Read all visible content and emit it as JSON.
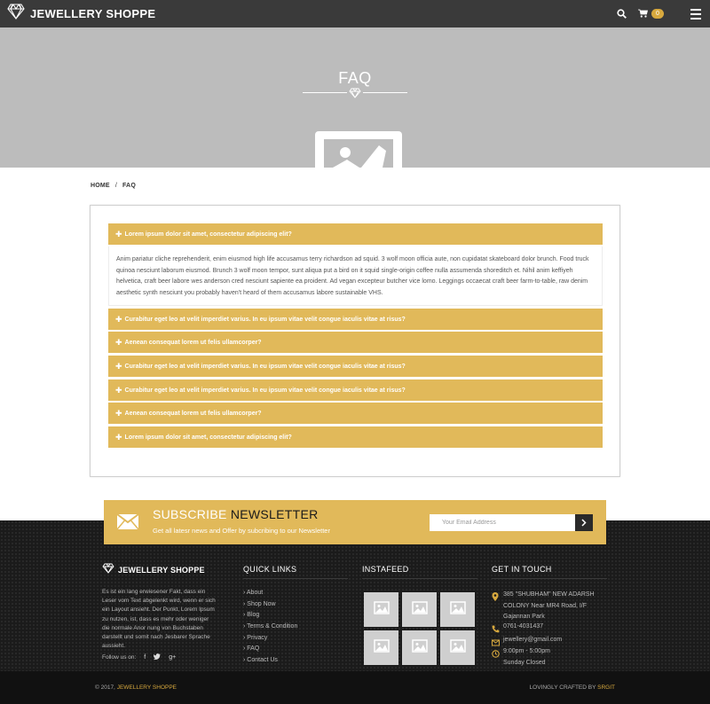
{
  "header": {
    "brand": "JEWELLERY SHOPPE",
    "cart_count": "0",
    "icons": [
      "diamond-logo-icon",
      "search-icon",
      "cart-icon",
      "menu-icon"
    ]
  },
  "hero": {
    "title": "FAQ"
  },
  "breadcrumb": {
    "home": "HOME",
    "separator": "/",
    "current": "FAQ"
  },
  "faq": {
    "items": [
      {
        "question": "Lorem ipsum dolor sit amet, consectetur adipiscing elit?"
      },
      {
        "question": "Curabitur eget leo at velit imperdiet varius. In eu ipsum vitae velit congue iaculis vitae at risus?"
      },
      {
        "question": "Aenean consequat lorem ut felis ullamcorper?"
      },
      {
        "question": "Curabitur eget leo at velit imperdiet varius. In eu ipsum vitae velit congue iaculis vitae at risus?"
      },
      {
        "question": "Curabitur eget leo at velit imperdiet varius. In eu ipsum vitae velit congue iaculis vitae at risus?"
      },
      {
        "question": "Aenean consequat lorem ut felis ullamcorper?"
      },
      {
        "question": "Lorem ipsum dolor sit amet, consectetur adipiscing elit?"
      }
    ],
    "open_answer": "Anim pariatur cliche reprehenderit, enim eiusmod high life accusamus terry richardson ad squid. 3 wolf moon officia aute, non cupidatat skateboard dolor brunch. Food truck quinoa nesciunt laborum eiusmod. Brunch 3 wolf moon tempor, sunt aliqua put a bird on it squid single-origin coffee nulla assumenda shoreditch et. Nihil anim keffiyeh helvetica, craft beer labore wes anderson cred nesciunt sapiente ea proident. Ad vegan excepteur butcher vice lomo. Leggings occaecat craft beer farm-to-table, raw denim aesthetic synth nesciunt you probably haven't heard of them accusamus labore sustainable VHS."
  },
  "newsletter": {
    "title_light": "SUBSCRIBE",
    "title_dark": "NEWSLETTER",
    "subtitle": "Get all latesr news and Offer by subcribing to our Newsletter",
    "placeholder": "Your Email Address"
  },
  "footer": {
    "brand": "JEWELLERY SHOPPE",
    "about": "Es ist ein lang erwiesener Fakt, dass ein Leser vom Text abgelenkt wird, wenn er sich ein Layout ansieht. Der Punkt, Lorem Ipsum zu nutzen, ist, dass es mehr oder weniger die normale Anor nung von Buchstaben darstellt und somit nach Jesbarer Sprache aussieht.",
    "follow_label": "Follow us on:",
    "social": [
      "f",
      "t",
      "g+"
    ],
    "quick_links_title": "QUICK LINKS",
    "quick_links": [
      "About",
      "Shop Now",
      "Blog",
      "Terms & Condition",
      "Privacy",
      "FAQ",
      "Contact Us"
    ],
    "instafeed_title": "INSTAFEED",
    "contact_title": "GET IN TOUCH",
    "address": [
      "385 \"SHUBHAM\" NEW ADARSH",
      "COLONY Near MR4 Road, I/F",
      "Gajannan Park"
    ],
    "phone": "0761-4031437",
    "email": "jewellery@gmail.com",
    "hours": [
      "9:00pm - 5:00pm",
      "Sunday Closed"
    ],
    "copyright_prefix": "© 2017,",
    "copyright_brand": "JEWELLERY SHOPPE",
    "credits_prefix": "LOVINGLY CRAFTED BY",
    "credits_brand": "SRGIT"
  },
  "colors": {
    "accent": "#e1b95a",
    "topbar": "#3a3a3a",
    "hero": "#bcbcbc",
    "footer": "#1b1b1b"
  }
}
